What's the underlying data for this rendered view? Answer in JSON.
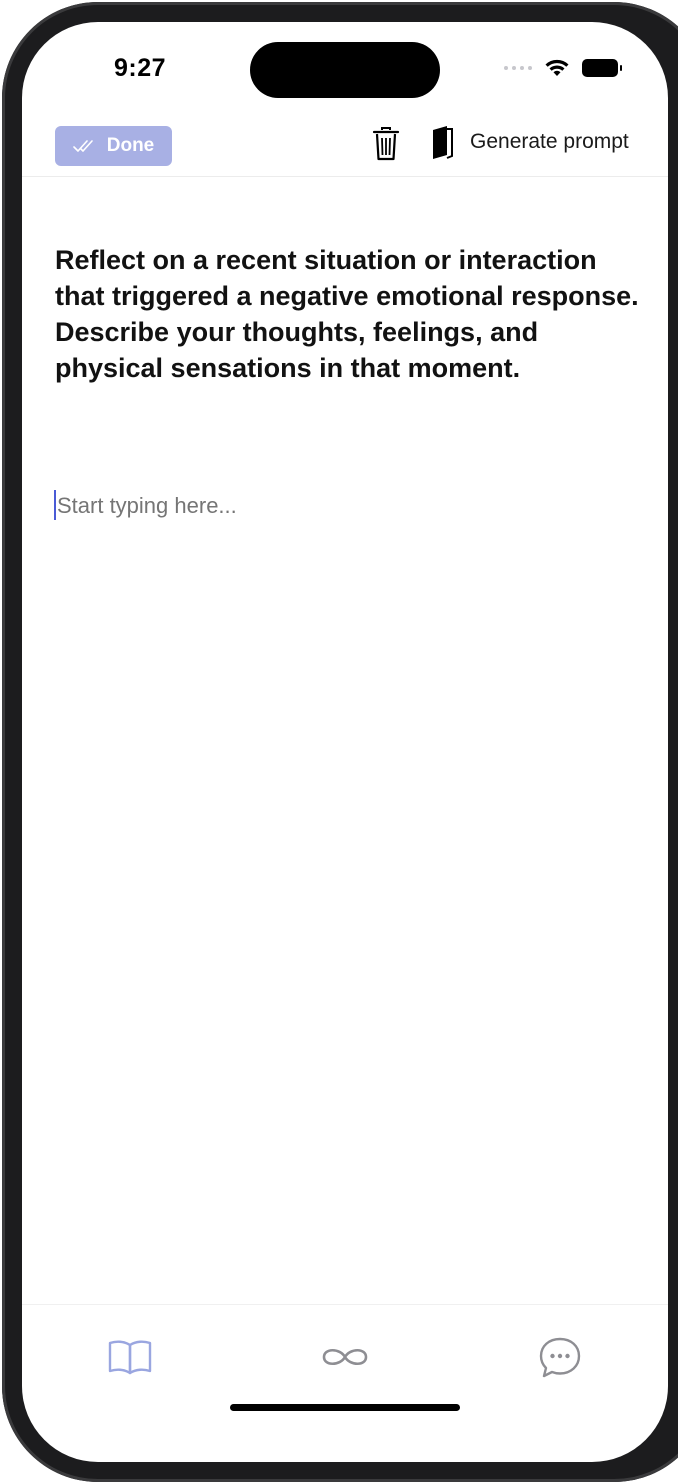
{
  "status_bar": {
    "time": "9:27"
  },
  "toolbar": {
    "done_label": "Done",
    "generate_label": "Generate prompt"
  },
  "prompt": {
    "text": "Reflect on a recent situation or interaction that triggered a negative emotional response. Describe your thoughts, feelings, and physical sensations in that moment."
  },
  "editor": {
    "placeholder": "Start typing here...",
    "value": ""
  },
  "tabbar": {
    "items": [
      {
        "icon": "open-book-icon",
        "active": true
      },
      {
        "icon": "infinity-icon",
        "active": false
      },
      {
        "icon": "chat-bubble-icon",
        "active": false
      }
    ]
  },
  "colors": {
    "accent": "#a8b0e4",
    "accent_icon": "#9aa6e0",
    "caret": "#4a5bd6",
    "inactive_icon": "#8e8e93"
  }
}
